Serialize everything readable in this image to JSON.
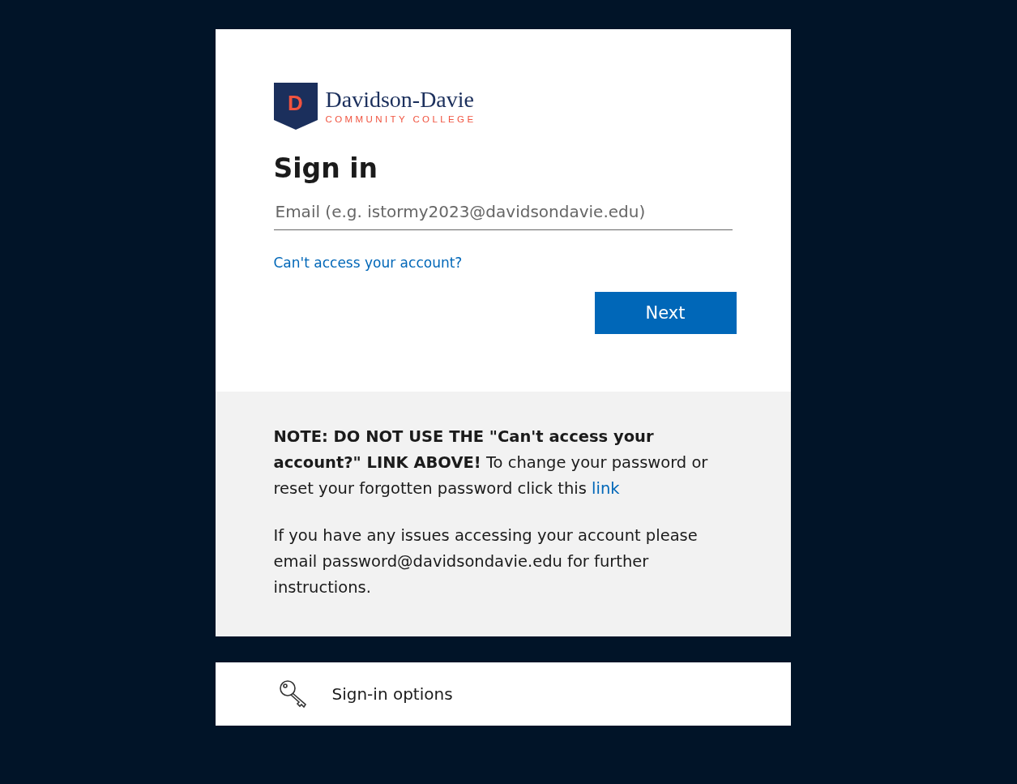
{
  "logo": {
    "initial": "D",
    "name": "Davidson-Davie",
    "subtitle": "COMMUNITY COLLEGE"
  },
  "title": "Sign in",
  "email_field": {
    "placeholder": "Email (e.g. istormy2023@davidsondavie.edu)"
  },
  "help_link": "Can't access your account?",
  "buttons": [
    "Next"
  ],
  "notes": [
    {
      "text": "**NOTE: DO NOT USE THE \"Can't access your account?\" LINK ABOVE!** To change your password or reset your forgotten password click this",
      "link": "link"
    },
    {
      "text": "If you have any issues accessing your account please email password@davidsondavie.edu for further instructions."
    }
  ],
  "options": {
    "label": "Sign-in options"
  }
}
